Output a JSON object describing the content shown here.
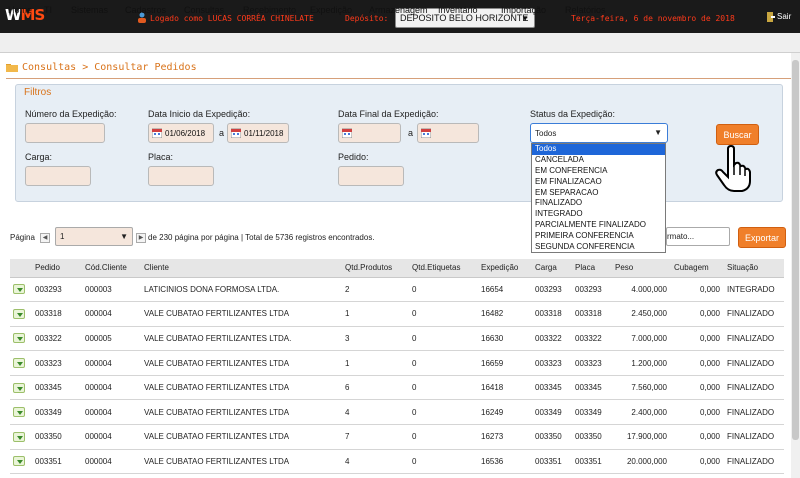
{
  "header": {
    "logo_w": "W",
    "logo_ms": "MS",
    "user_text": "Logado como LUCAS CORRÊA CHINELATE",
    "deposit_label": "Depósito:",
    "deposit_value": "DEPOSITO BELO HORIZONTE",
    "date_text": "Terça-feira, 6 de novembro de 2018",
    "exit_label": "Sair"
  },
  "menu": [
    "Home",
    "TI",
    "Sistemas",
    "Cadastros",
    "Consultas",
    "Recebimento",
    "Expedição",
    "Armazenagem",
    "Inventário",
    "Importação",
    "Relatórios"
  ],
  "breadcrumb": "Consultas > Consultar Pedidos",
  "filters": {
    "title": "Filtros",
    "numero_label": "Número da Expedição:",
    "data_inicio_label": "Data Inicio da Expedição:",
    "data_inicio_from": "01/06/2018",
    "data_inicio_to": "01/11/2018",
    "separator": "a",
    "data_final_label": "Data Final da Expedição:",
    "status_label": "Status da Expedição:",
    "status_value": "Todos",
    "carga_label": "Carga:",
    "placa_label": "Placa:",
    "pedido_label": "Pedido:",
    "buscar": "Buscar",
    "status_options": [
      "Todos",
      "CANCELADA",
      "EM CONFERENCIA",
      "EM FINALIZACAO",
      "EM SEPARACAO",
      "FINALIZADO",
      "INTEGRADO",
      "PARCIALMENTE FINALIZADO",
      "PRIMEIRA CONFERENCIA",
      "SEGUNDA CONFERENCIA"
    ]
  },
  "pager": {
    "label": "Página",
    "page_value": "1",
    "info": "de 230 página por página | Total de 5736 registros encontrados.",
    "format_value": "rmato...",
    "export": "Exportar"
  },
  "table": {
    "headers": [
      "",
      "Pedido",
      "Cód.Cliente",
      "Cliente",
      "Qtd.Produtos",
      "Qtd.Etiquetas",
      "Expedição",
      "Carga",
      "Placa",
      "Peso",
      "Cubagem",
      "Situação"
    ],
    "rows": [
      [
        "003293",
        "000003",
        "LATICINIOS DONA FORMOSA LTDA.",
        "2",
        "0",
        "16654",
        "003293",
        "003293",
        "4.000,000",
        "0,000",
        "INTEGRADO"
      ],
      [
        "003318",
        "000004",
        "VALE CUBATAO FERTILIZANTES LTDA",
        "1",
        "0",
        "16482",
        "003318",
        "003318",
        "2.450,000",
        "0,000",
        "FINALIZADO"
      ],
      [
        "003322",
        "000005",
        "VALE CUBATAO FERTILIZANTES LTDA.",
        "3",
        "0",
        "16630",
        "003322",
        "003322",
        "7.000,000",
        "0,000",
        "FINALIZADO"
      ],
      [
        "003323",
        "000004",
        "VALE CUBATAO FERTILIZANTES LTDA",
        "1",
        "0",
        "16659",
        "003323",
        "003323",
        "1.200,000",
        "0,000",
        "FINALIZADO"
      ],
      [
        "003345",
        "000004",
        "VALE CUBATAO FERTILIZANTES LTDA",
        "6",
        "0",
        "16418",
        "003345",
        "003345",
        "7.560,000",
        "0,000",
        "FINALIZADO"
      ],
      [
        "003349",
        "000004",
        "VALE CUBATAO FERTILIZANTES LTDA",
        "4",
        "0",
        "16249",
        "003349",
        "003349",
        "2.400,000",
        "0,000",
        "FINALIZADO"
      ],
      [
        "003350",
        "000004",
        "VALE CUBATAO FERTILIZANTES LTDA",
        "7",
        "0",
        "16273",
        "003350",
        "003350",
        "17.900,000",
        "0,000",
        "FINALIZADO"
      ],
      [
        "003351",
        "000004",
        "VALE CUBATAO FERTILIZANTES LTDA",
        "4",
        "0",
        "16536",
        "003351",
        "003351",
        "20.000,000",
        "0,000",
        "FINALIZADO"
      ]
    ]
  },
  "colors": {
    "accent": "#f07f2a",
    "header_bg": "#1a1a1a",
    "top_text": "#ff3a1a"
  }
}
